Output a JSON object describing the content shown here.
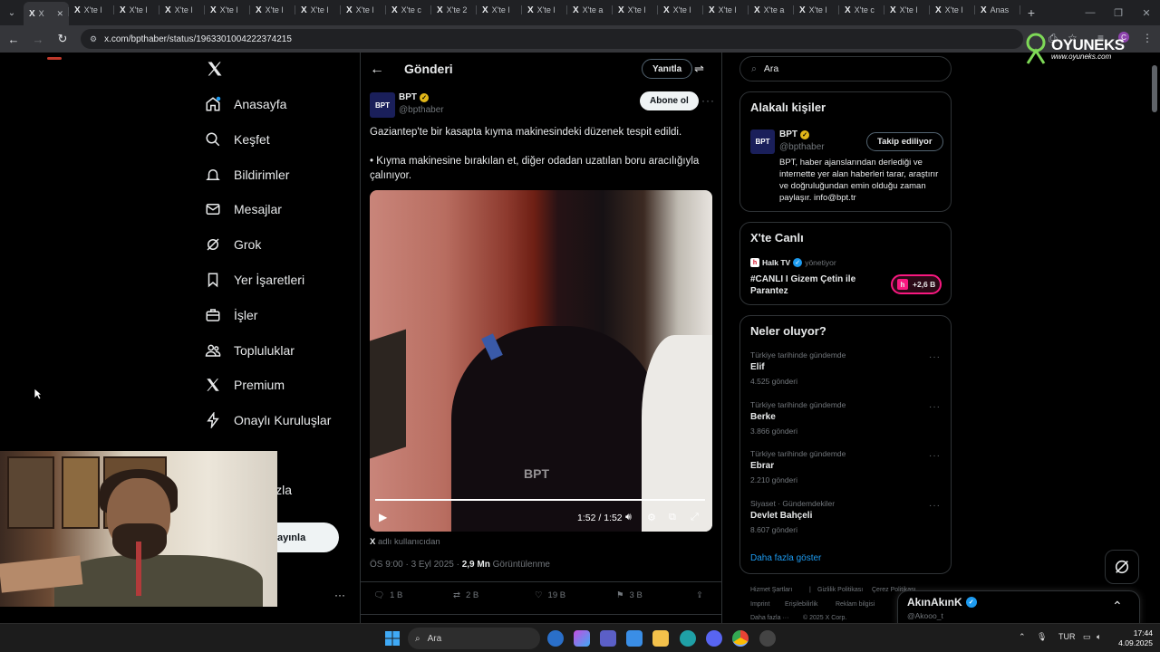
{
  "browser": {
    "tabs": [
      {
        "title": "X",
        "active": true
      },
      {
        "title": "X'te l"
      },
      {
        "title": "X'te l"
      },
      {
        "title": "X'te l"
      },
      {
        "title": "X'te l"
      },
      {
        "title": "X'te l"
      },
      {
        "title": "X'te l"
      },
      {
        "title": "X'te l"
      },
      {
        "title": "X'te c"
      },
      {
        "title": "X'te 2"
      },
      {
        "title": "X'te l"
      },
      {
        "title": "X'te l"
      },
      {
        "title": "X'te a"
      },
      {
        "title": "X'te l"
      },
      {
        "title": "X'te l"
      },
      {
        "title": "X'te l"
      },
      {
        "title": "X'te a"
      },
      {
        "title": "X'te l"
      },
      {
        "title": "X'te c"
      },
      {
        "title": "X'te l"
      },
      {
        "title": "X'te l"
      },
      {
        "title": "Anas"
      }
    ],
    "url": "x.com/bpthaber/status/1963301004222374215"
  },
  "watermark": {
    "brand": "OYUNEKS",
    "url": "www.oyuneks.com"
  },
  "nav": {
    "items": [
      {
        "label": "Anasayfa",
        "icon": "home-icon"
      },
      {
        "label": "Keşfet",
        "icon": "search-icon"
      },
      {
        "label": "Bildirimler",
        "icon": "bell-icon"
      },
      {
        "label": "Mesajlar",
        "icon": "mail-icon"
      },
      {
        "label": "Grok",
        "icon": "grok-icon"
      },
      {
        "label": "Yer İşaretleri",
        "icon": "bookmark-icon"
      },
      {
        "label": "İşler",
        "icon": "briefcase-icon"
      },
      {
        "label": "Topluluklar",
        "icon": "people-icon"
      },
      {
        "label": "Premium",
        "icon": "x-icon"
      },
      {
        "label": "Onaylı Kuruluşlar",
        "icon": "lightning-icon"
      }
    ],
    "partial_label": "zla",
    "golive_label": "ayınla"
  },
  "post": {
    "header_title": "Gönderi",
    "reply_button": "Yanıtla",
    "author_name": "BPT",
    "author_handle": "@bpthaber",
    "avatar_text": "BPT",
    "subscribe_button": "Abone ol",
    "text_line1": "Gaziantep'te bir kasapta kıyma makinesindeki düzenek tespit edildi.",
    "text_line2": "• Kıyma makinesine bırakılan et, diğer odadan uzatılan boru aracılığıyla çalınıyor.",
    "video": {
      "time": "1:52 / 1:52",
      "watermark": "BPT",
      "progress": 1.0
    },
    "source_prefix": "X",
    "source_text": "adlı kullanıcıdan",
    "timestamp": "ÖS 9:00 · 3 Eyl 2025 · ",
    "views_count": "2,9 Mn",
    "views_label": "Görüntülenme",
    "stats": {
      "replies": "1 B",
      "reposts": "2 B",
      "likes": "19 B",
      "bookmarks": "3 B"
    }
  },
  "right": {
    "search_placeholder": "Ara",
    "relevant": {
      "title": "Alakalı kişiler",
      "name": "BPT",
      "handle": "@bpthaber",
      "button": "Takip ediliyor",
      "bio": "BPT, haber ajanslarından derlediği ve internette yer alan haberleri tarar, araştırır ve doğruluğundan emin olduğu zaman paylaşır. info@bpt.tr"
    },
    "live": {
      "title": "X'te Canlı",
      "host": "Halk TV",
      "host_suffix": "yönetiyor",
      "stream_title": "#CANLI I Gizem Çetin ile Parantez",
      "listeners": "+2,6 B"
    },
    "trends": {
      "title": "Neler oluyor?",
      "items": [
        {
          "category": "Türkiye tarihinde gündemde",
          "name": "Elif",
          "count": "4.525 gönderi"
        },
        {
          "category": "Türkiye tarihinde gündemde",
          "name": "Berke",
          "count": "3.866 gönderi"
        },
        {
          "category": "Türkiye tarihinde gündemde",
          "name": "Ebrar",
          "count": "2.210 gönderi"
        },
        {
          "category": "Siyaset · Gündemdekiler",
          "name": "Devlet Bahçeli",
          "count": "8.607 gönderi"
        }
      ],
      "show_more": "Daha fazla göster"
    },
    "footer": {
      "l1a": "Hizmet Şartları",
      "l1b": "Gizlilik Politikası",
      "l1c": "Çerez Politikası",
      "l2a": "Imprint",
      "l2b": "Erişilebilirlik",
      "l2c": "Reklam bilgisi",
      "l3a": "Daha fazla ···",
      "l3b": "© 2025 X Corp."
    }
  },
  "drawer": {
    "name": "AkınAkınK",
    "handle": "@Akooo_t"
  },
  "taskbar": {
    "search_placeholder": "Ara",
    "lang": "TUR",
    "time": "17:44",
    "date": "4.09.2025"
  },
  "colors": {
    "accent": "#1d9bf0",
    "gold_badge": "#e2b719",
    "live_red": "#f91880"
  }
}
